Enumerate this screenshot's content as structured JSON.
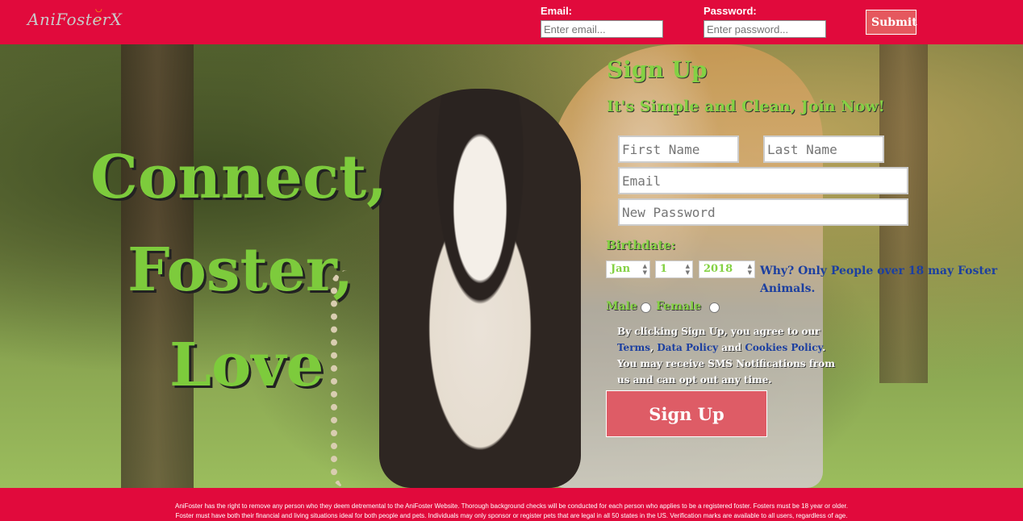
{
  "header": {
    "logo": "AniFosterX",
    "email_label": "Email:",
    "email_placeholder": "Enter email...",
    "password_label": "Password:",
    "password_placeholder": "Enter password...",
    "submit_label": "Submit"
  },
  "hero": {
    "slogan_line1": "Connect,",
    "slogan_line2": "Foster,",
    "slogan_line3": "Love"
  },
  "signup": {
    "title": "Sign Up",
    "subtitle": "It's Simple and Clean, Join Now!",
    "first_name_placeholder": "First Name",
    "last_name_placeholder": "Last Name",
    "email_placeholder": "Email",
    "password_placeholder": "New Password",
    "birthdate_label": "Birthdate:",
    "month": "Jan",
    "day": "1",
    "year": "2018",
    "why_text": "Why? Only People over 18 may Foster Animals.",
    "male_label": "Male",
    "female_label": "Female",
    "terms_prefix": "By clicking Sign Up, you agree to our",
    "terms_link": "Terms",
    "data_policy_link": "Data Policy",
    "and_text": "and",
    "cookies_link": "Cookies Policy",
    "terms_suffix": "You may receive SMS Notifications from us and can opt out any time.",
    "button_label": "Sign Up"
  },
  "footer": {
    "line1": "AniFoster has the right to remove any person who they deem detremental to the AniFoster Website. Thorough background checks will be conducted for each person who applies to be a registered foster. Fosters must be 18 year or older.",
    "line2": "Foster must have both their financial and living situations ideal for both people and pets. Individuals may only sponsor or register pets that are legal in all 50 states in the US. Verification marks are available to all users, regardless of age."
  },
  "colors": {
    "brand_red": "#e10a3c",
    "accent_green": "#84d144",
    "link_blue": "#1c3fa0",
    "button_pink": "#de5c66"
  }
}
